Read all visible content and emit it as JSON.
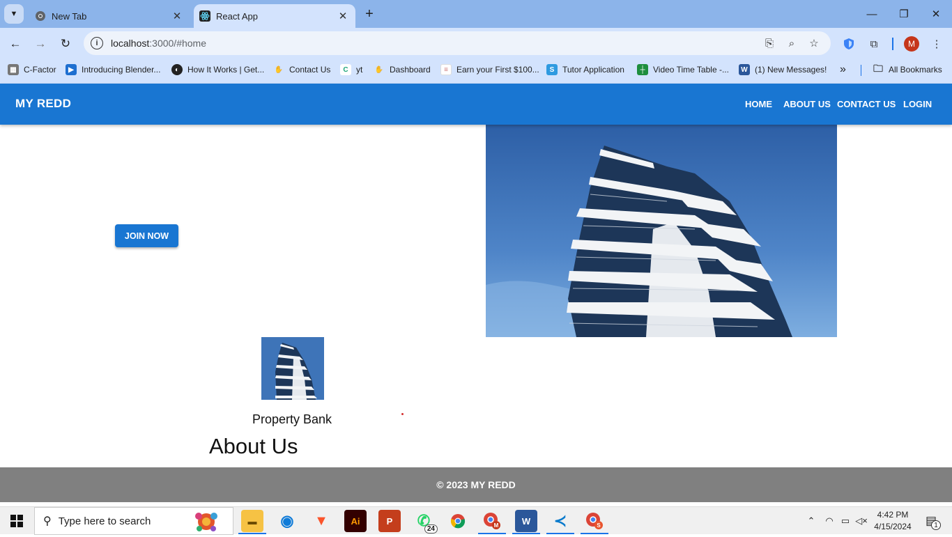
{
  "browser": {
    "tabs": [
      {
        "title": "New Tab",
        "icon": "chrome-icon",
        "active": false
      },
      {
        "title": "React App",
        "icon": "react-icon",
        "active": true
      }
    ],
    "url_host": "localhost",
    "url_rest": ":3000/#home",
    "profile_initial": "M",
    "bookmarks": [
      {
        "label": "C-Factor",
        "icon": "cfactor-icon",
        "color": "#555555"
      },
      {
        "label": "Introducing Blender...",
        "icon": "video-icon",
        "color": "#1e6fd0"
      },
      {
        "label": "How It Works | Get...",
        "icon": "globe-icon",
        "color": "#222222"
      },
      {
        "label": "Contact Us",
        "icon": "handshake-icon",
        "color": "#4caf50"
      },
      {
        "label": "yt",
        "icon": "c-icon",
        "color": "#1ea67a"
      },
      {
        "label": "Dashboard",
        "icon": "handshake-icon",
        "color": "#4caf50"
      },
      {
        "label": "Earn your First $100...",
        "icon": "doc-icon",
        "color": "#ffffff"
      },
      {
        "label": "Tutor Application",
        "icon": "s-icon",
        "color": "#2f9ae0"
      },
      {
        "label": "Video Time Table -...",
        "icon": "sheets-icon",
        "color": "#1e8e3e"
      },
      {
        "label": "(1) New Messages!",
        "icon": "word-icon",
        "color": "#2b579a"
      }
    ],
    "more_bookmarks": "»",
    "all_bookmarks": "All Bookmarks"
  },
  "app": {
    "brand": "MY REDD",
    "nav": [
      "HOME",
      "ABOUT US",
      "CONTACT US",
      "LOGIN"
    ],
    "join_button": "JOIN NOW",
    "property_caption": "Property Bank",
    "about_title": "About Us",
    "footer": "© 2023 MY REDD",
    "primary_color": "#1976d2"
  },
  "taskbar": {
    "search_placeholder": "Type here to search",
    "whatsapp_badge": "24",
    "time": "4:42 PM",
    "date": "4/15/2024",
    "notification_count": "1"
  }
}
